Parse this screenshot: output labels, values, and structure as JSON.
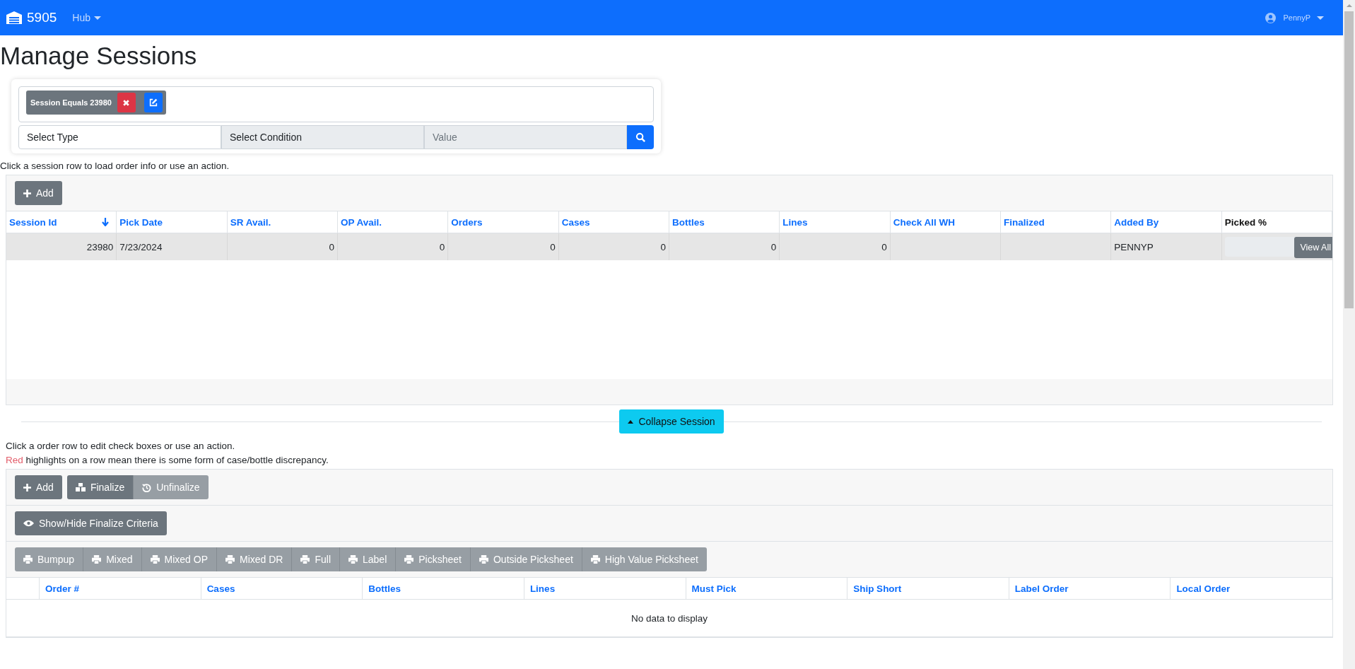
{
  "navbar": {
    "brand": "5905",
    "menu": "Hub",
    "user": "PennyP"
  },
  "title": "Manage Sessions",
  "filter": {
    "chips": [
      {
        "text": "Session Equals 23980"
      }
    ],
    "type_placeholder": "Select Type",
    "condition_placeholder": "Select Condition",
    "value_placeholder": "Value"
  },
  "session_hint": "Click a session row to load order info or use an action.",
  "sessions": {
    "add": "Add",
    "columns": [
      {
        "label": "Session Id",
        "sorted": true,
        "sortable": true
      },
      {
        "label": "Pick Date",
        "sorted": false,
        "sortable": true
      },
      {
        "label": "SR Avail.",
        "sorted": false,
        "sortable": true
      },
      {
        "label": "OP Avail.",
        "sorted": false,
        "sortable": true
      },
      {
        "label": "Orders",
        "sorted": false,
        "sortable": true
      },
      {
        "label": "Cases",
        "sorted": false,
        "sortable": true
      },
      {
        "label": "Bottles",
        "sorted": false,
        "sortable": true
      },
      {
        "label": "Lines",
        "sorted": false,
        "sortable": true
      },
      {
        "label": "Check All WH",
        "sorted": false,
        "sortable": true
      },
      {
        "label": "Finalized",
        "sorted": false,
        "sortable": true
      },
      {
        "label": "Added By",
        "sorted": false,
        "sortable": true
      },
      {
        "label": "Picked %",
        "sorted": false,
        "sortable": false
      }
    ],
    "rows": [
      {
        "cells": [
          "23980",
          "7/23/2024",
          "0",
          "0",
          "0",
          "0",
          "0",
          "0",
          null,
          null,
          "PENNYP"
        ],
        "level": 0,
        "action": "View All",
        "selected": true
      }
    ]
  },
  "collapse": "Collapse Session",
  "order_hints": [
    "Click a order row to edit check boxes or use an action.",
    "Red highlights on a row mean there is some form of case/bottle discrepancy."
  ],
  "orders": {
    "add": "Add",
    "actions": [
      {
        "label": "Finalize",
        "disabled": false
      },
      {
        "label": "Unfinalize",
        "disabled": true
      }
    ],
    "criteria": "Show/Hide Finalize Criteria",
    "prints": [
      {
        "label": "Bumpup",
        "disabled": true
      },
      {
        "label": "Mixed",
        "disabled": true
      },
      {
        "label": "Mixed OP",
        "disabled": true
      },
      {
        "label": "Mixed DR",
        "disabled": true
      },
      {
        "label": "Full",
        "disabled": true
      },
      {
        "label": "Label",
        "disabled": true
      },
      {
        "label": "Picksheet",
        "disabled": true
      },
      {
        "label": "Outside Picksheet",
        "disabled": true
      },
      {
        "label": "High Value Picksheet",
        "disabled": true
      }
    ],
    "columns": [
      "Order #",
      "Cases",
      "Bottles",
      "Lines",
      "Must Pick",
      "Ship Short",
      "Label Order",
      "Local Order"
    ],
    "empty": "No data to display"
  }
}
